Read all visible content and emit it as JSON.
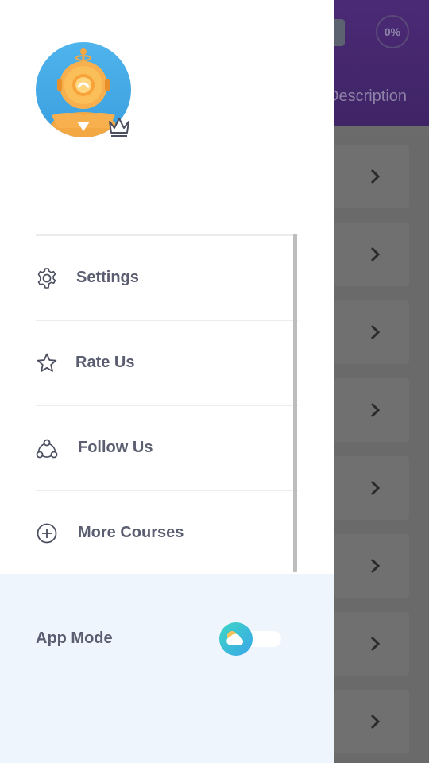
{
  "background": {
    "progress_text": "0%",
    "tab_label": "Description",
    "row_count": 8
  },
  "drawer": {
    "menu": [
      {
        "key": "settings",
        "label": "Settings",
        "icon": "gear-icon"
      },
      {
        "key": "rate-us",
        "label": "Rate Us",
        "icon": "star-icon"
      },
      {
        "key": "follow-us",
        "label": "Follow Us",
        "icon": "share-network-icon"
      },
      {
        "key": "more-courses",
        "label": "More Courses",
        "icon": "plus-circle-icon"
      }
    ],
    "app_mode": {
      "label": "App Mode",
      "toggle_state": "light"
    }
  },
  "colors": {
    "header": "#4b2a75",
    "menu_text": "#5b5e70",
    "app_mode_bg": "#eef5fd",
    "toggle_knob": "#3ec0d6"
  }
}
